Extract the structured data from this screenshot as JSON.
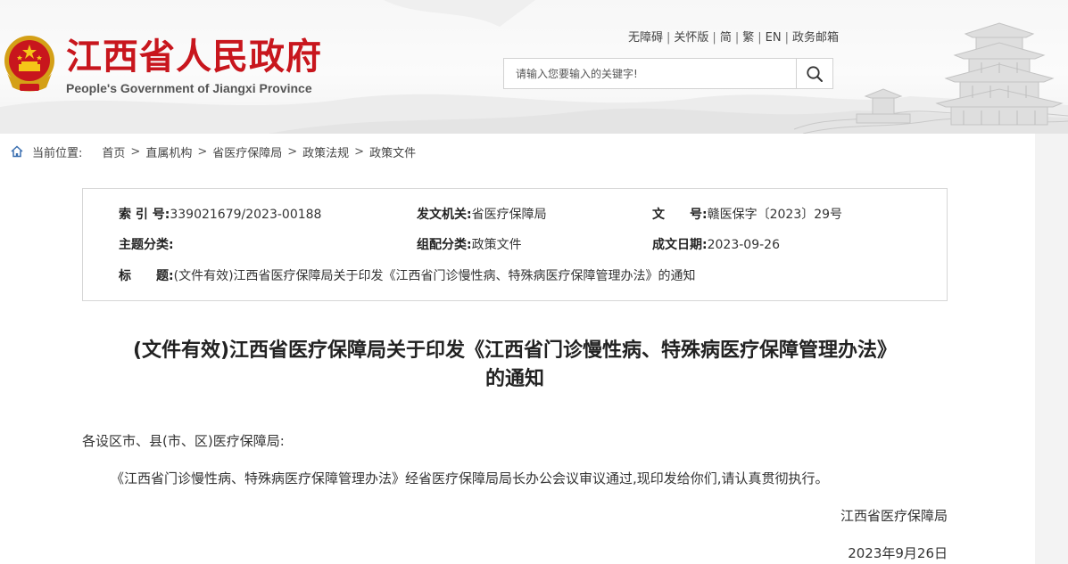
{
  "header": {
    "title": "江西省人民政府",
    "subtitle": "People's Government of Jiangxi Province",
    "toplinks": [
      "无障碍",
      "关怀版",
      "简",
      "繁",
      "EN",
      "政务邮箱"
    ],
    "search_placeholder": "请输入您要输入的关键字!",
    "colors": {
      "brand_red": "#c8161d"
    }
  },
  "breadcrumb": {
    "label": "当前位置:",
    "items": [
      "首页",
      "直属机构",
      "省医疗保障局",
      "政策法规",
      "政策文件"
    ]
  },
  "meta": {
    "index_key": "索 引 号:",
    "index_value": "339021679/2023-00188",
    "issuer_key": "发文机关:",
    "issuer_value": "省医疗保障局",
    "docno_key": "文　　号:",
    "docno_value": "赣医保字〔2023〕29号",
    "topic_key": "主题分类:",
    "topic_value": "",
    "category_key": "组配分类:",
    "category_value": "政策文件",
    "date_key": "成文日期:",
    "date_value": "2023-09-26",
    "title_key": "标　　题:",
    "title_value": "(文件有效)江西省医疗保障局关于印发《江西省门诊慢性病、特殊病医疗保障管理办法》的通知"
  },
  "document": {
    "title_line1": "(文件有效)江西省医疗保障局关于印发《江西省门诊慢性病、特殊病医疗保障管理办法》",
    "title_line2": "的通知",
    "salutation": "各设区市、县(市、区)医疗保障局:",
    "body": "《江西省门诊慢性病、特殊病医疗保障管理办法》经省医疗保障局局长办公会议审议通过,现印发给你们,请认真贯彻执行。",
    "signature": "江西省医疗保障局",
    "date": "2023年9月26日"
  }
}
